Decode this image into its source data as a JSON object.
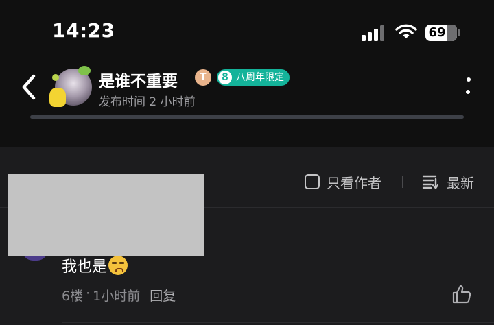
{
  "status_bar": {
    "time": "14:23",
    "battery": "69",
    "icons": [
      "cellular-signal-icon",
      "wifi-icon",
      "battery-icon"
    ]
  },
  "post_header": {
    "username": "是谁不重要",
    "level_badge": "T",
    "anniversary_badge": {
      "number": "8",
      "label": "八周年限定"
    },
    "post_time": "发布时间 2 小时前",
    "icons": [
      "back-chevron-icon",
      "more-options-icon"
    ]
  },
  "filters": {
    "only_author": "只看作者",
    "sort": "最新",
    "icons": [
      "checkbox-icon",
      "sort-list-icon"
    ]
  },
  "comment": {
    "text": "我也是",
    "floor": "6楼",
    "separator": "·",
    "time": "1小时前",
    "reply": "回复",
    "icons": [
      "emoji-icon",
      "thumbs-up-icon"
    ]
  },
  "colors": {
    "background": "#1c1c1e",
    "header_background": "#101010",
    "badge_teal": "#14b39a",
    "redaction": "#c3c3c3"
  }
}
